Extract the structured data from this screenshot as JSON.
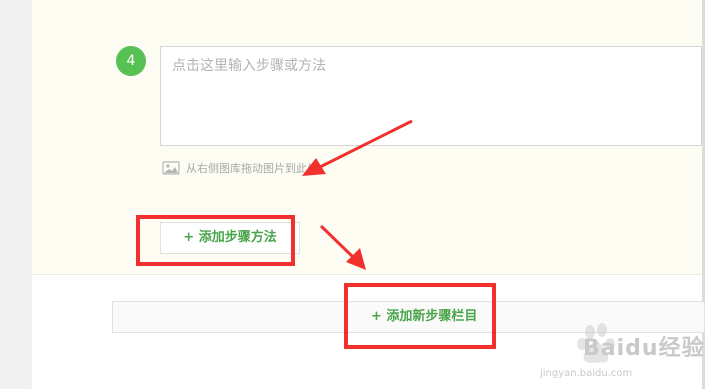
{
  "step": {
    "number": "4",
    "placeholder": "点击这里输入步骤或方法",
    "drag_hint": "从右侧图库拖动图片到此处"
  },
  "buttons": {
    "add_method": "+ 添加步骤方法",
    "add_section": "+ 添加新步骤栏目"
  },
  "watermark": {
    "brand": "Baidu经验",
    "sub": "jingyan.baidu.com"
  },
  "colors": {
    "accent_green": "#57c154",
    "button_text_green": "#4aa54a",
    "annotation_red": "#f2302d",
    "panel_bg": "#fdfdf3"
  }
}
